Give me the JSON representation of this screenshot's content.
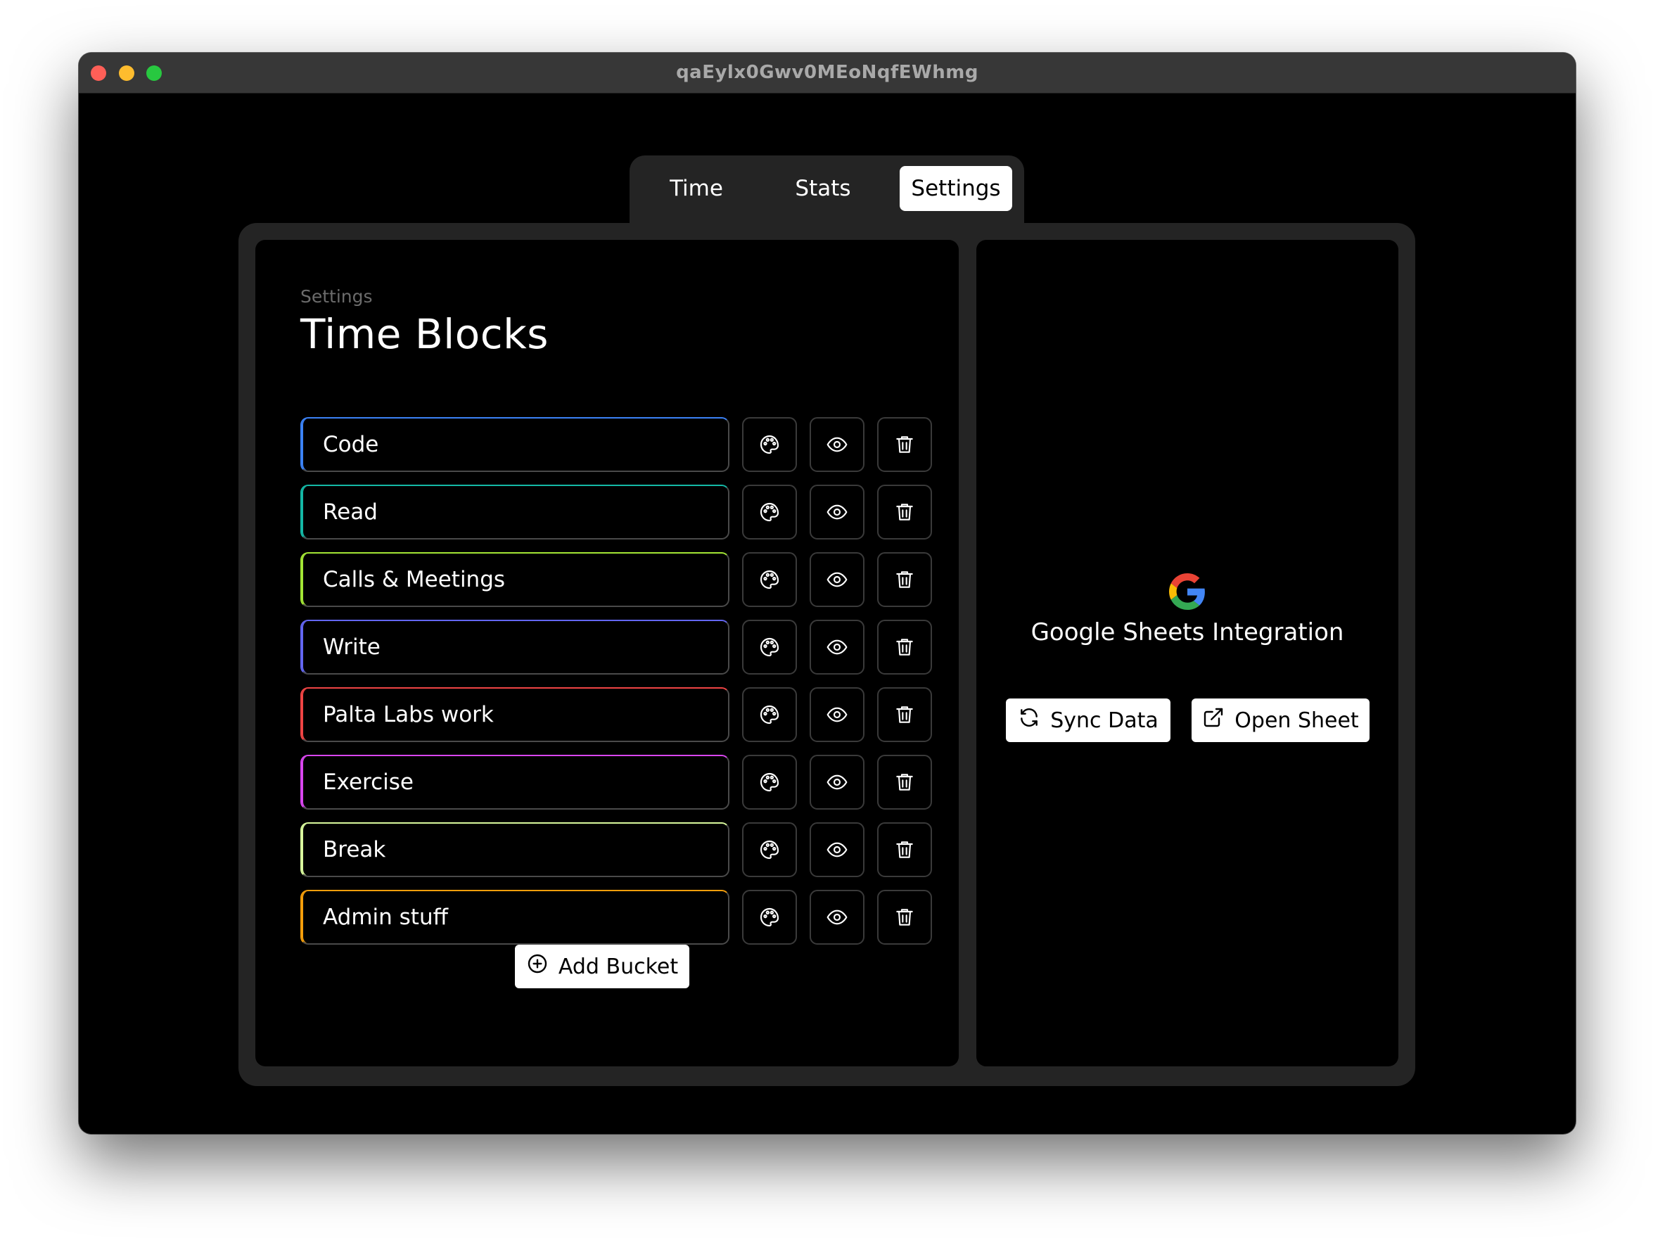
{
  "window": {
    "title": "qaEylx0Gwv0MEoNqfEWhmg"
  },
  "tabs": [
    {
      "label": "Time",
      "active": false
    },
    {
      "label": "Stats",
      "active": false
    },
    {
      "label": "Settings",
      "active": true
    }
  ],
  "settings": {
    "breadcrumb": "Settings",
    "title": "Time Blocks",
    "buckets": [
      {
        "name": "Code",
        "color": "#3b82f6"
      },
      {
        "name": "Read",
        "color": "#14b8a6"
      },
      {
        "name": "Calls & Meetings",
        "color": "#a3e635"
      },
      {
        "name": "Write",
        "color": "#6366f1"
      },
      {
        "name": "Palta Labs work",
        "color": "#ef4444"
      },
      {
        "name": "Exercise",
        "color": "#d946ef"
      },
      {
        "name": "Break",
        "color": "#d9f99d"
      },
      {
        "name": "Admin stuff",
        "color": "#f59e0b"
      }
    ],
    "row_icons": [
      "palette-icon",
      "eye-icon",
      "trash-icon"
    ],
    "add_bucket_label": "Add Bucket"
  },
  "integration": {
    "title": "Google Sheets Integration",
    "sync_label": "Sync Data",
    "open_label": "Open Sheet"
  }
}
